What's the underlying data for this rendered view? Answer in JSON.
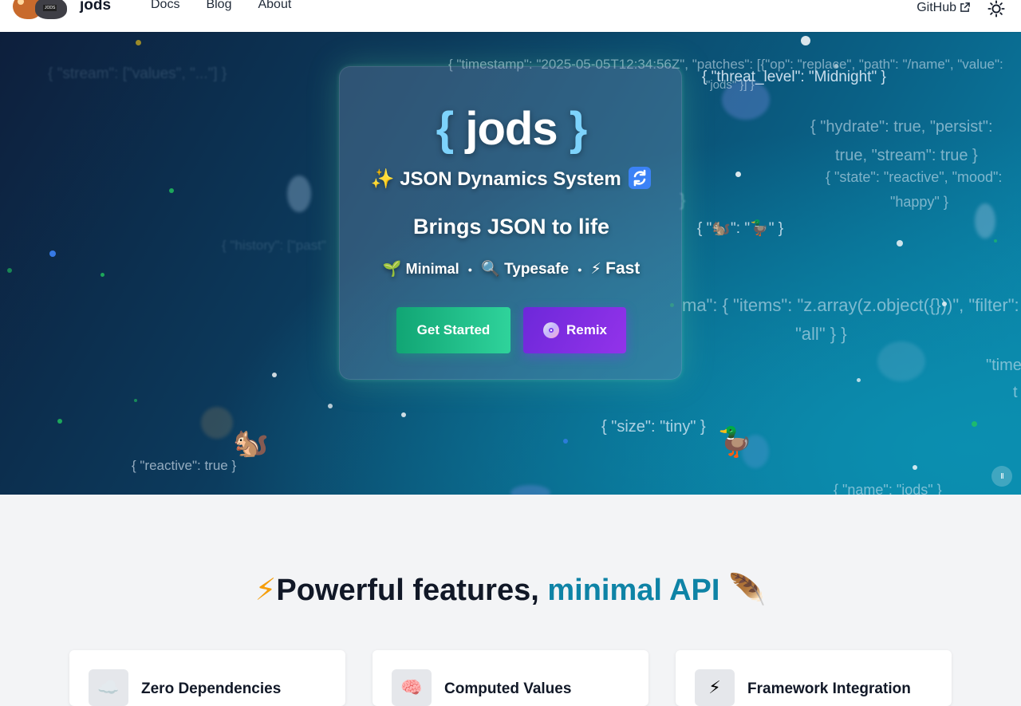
{
  "nav": {
    "brand": "jods",
    "links": [
      "Docs",
      "Blog",
      "About"
    ],
    "github": "GitHub"
  },
  "hero": {
    "title_open": "{",
    "title_word": "jods",
    "title_close": "}",
    "subtitle_sparkle": "✨",
    "subtitle": "JSON Dynamics System",
    "tagline": "Brings JSON to life",
    "features": [
      {
        "icon": "🌱",
        "label": "Minimal"
      },
      {
        "icon": "🔍",
        "label": "Typesafe"
      },
      {
        "icon": "⚡",
        "label": "Fast"
      }
    ],
    "separator": "•",
    "primary_button": "Get Started",
    "secondary_button": "Remix",
    "pause_glyph": "II",
    "mascot_squirrel": "🐿️",
    "mascot_duck": "🦆",
    "floating_json": [
      "{ \"timestamp\": \"2025-05-05T12:34:56Z\", \"patches\": [{\"op\": \"replace\", \"path\": \"/name\", \"value\":",
      "\"jods\" }] }",
      "{ \"threat_level\": \"Midnight\" }",
      "{ \"hydrate\": true, \"persist\":",
      "true, \"stream\": true }",
      "{ \"state\": \"reactive\", \"mood\":",
      "\"happy\" }",
      "{ \"🐿️\": \"🦆\" }",
      "ma\": { \"items\": \"z.array(z.object({}))\", \"filter\":",
      "\"all\" } }",
      "\"time",
      "t",
      "{ \"size\": \"tiny\" }",
      "{ \"reactive\": true }",
      "{ \"name\": \"jods\" }",
      "{ \"stream\": [\"values\", \"...\"] }",
      "{ \"history\": [\"past\"",
      "}"
    ]
  },
  "features_section": {
    "title_icon": "⚡",
    "title_main": "Powerful features, ",
    "title_accent": "minimal API",
    "title_end_icon": "🪶",
    "cards": [
      {
        "icon": "☁️",
        "label": "Zero Dependencies"
      },
      {
        "icon": "🧠",
        "label": "Computed Values"
      },
      {
        "icon": "⚡",
        "label": "Framework Integration"
      }
    ]
  }
}
